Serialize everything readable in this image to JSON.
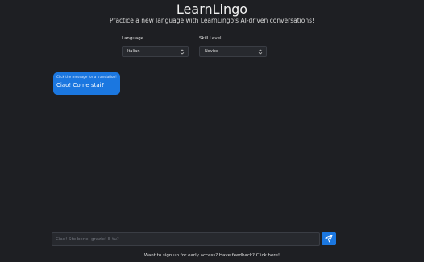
{
  "header": {
    "title": "LearnLingo",
    "subtitle": "Practice a new language with LearnLingo's AI-driven conversations!"
  },
  "settings": {
    "language": {
      "label": "Language",
      "selected": "Italian"
    },
    "skill_level": {
      "label": "Skill Level",
      "selected": "Novice"
    }
  },
  "chat": {
    "messages": [
      {
        "hint": "Click the message for a translation!",
        "text": "Ciao! Come stai?"
      }
    ]
  },
  "composer": {
    "placeholder": "Ciao! Sto bene, grazie! E tu?",
    "send_icon": "send-icon",
    "accent_color": "#1b77e0"
  },
  "footer": {
    "text": "Want to sign up for early access? Have feedback? Click here!"
  }
}
